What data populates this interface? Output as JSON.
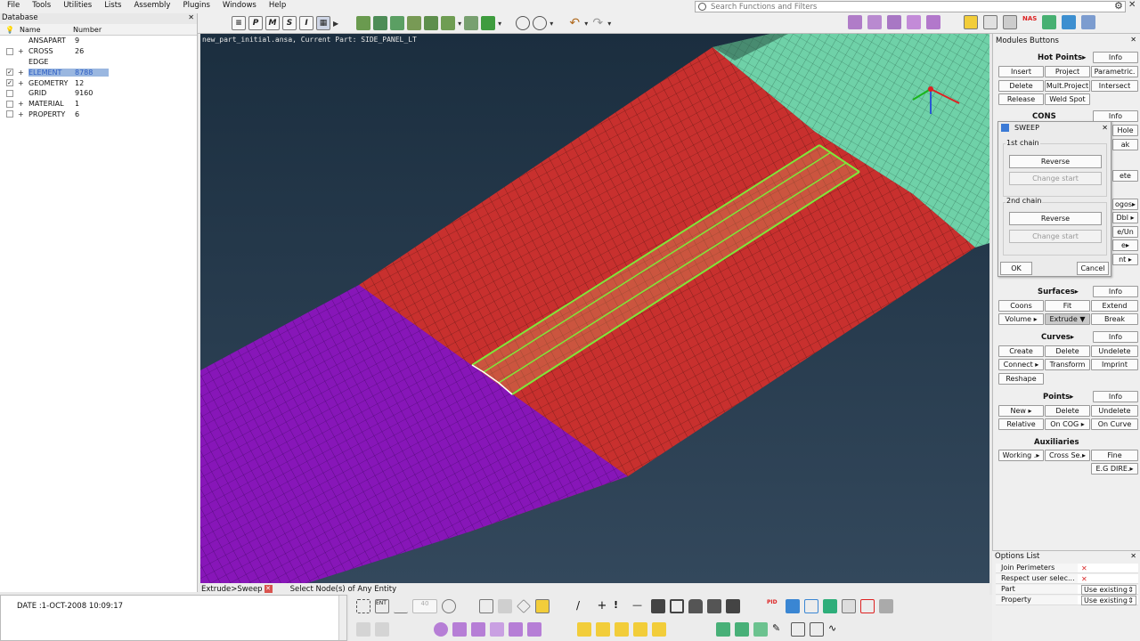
{
  "menu": [
    "File",
    "Tools",
    "Utilities",
    "Lists",
    "Assembly",
    "Plugins",
    "Windows",
    "Help"
  ],
  "search": {
    "placeholder": "Search Functions and Filters"
  },
  "database": {
    "title": "Database",
    "columns": {
      "name": "Name",
      "number": "Number"
    },
    "rows": [
      {
        "name": "ANSAPART",
        "number": "9",
        "checked": false,
        "expandable": false,
        "selected": false
      },
      {
        "name": "CROSS",
        "number": "26",
        "checked": false,
        "expandable": true,
        "selected": false
      },
      {
        "name": "EDGE",
        "number": "",
        "checked": false,
        "expandable": false,
        "selected": false
      },
      {
        "name": "ELEMENT",
        "number": "8788",
        "checked": true,
        "expandable": true,
        "selected": true
      },
      {
        "name": "GEOMETRY",
        "number": "12",
        "checked": true,
        "expandable": true,
        "selected": false
      },
      {
        "name": "GRID",
        "number": "9160",
        "checked": false,
        "expandable": false,
        "selected": false
      },
      {
        "name": "MATERIAL",
        "number": "1",
        "checked": false,
        "expandable": true,
        "selected": false
      },
      {
        "name": "PROPERTY",
        "number": "6",
        "checked": false,
        "expandable": true,
        "selected": false
      }
    ]
  },
  "viewport": {
    "caption": "new_part_initial.ansa,  Current Part: SIDE_PANEL_LT"
  },
  "status": {
    "operation": "Extrude>Sweep",
    "message": "Select Node(s) of Any Entity"
  },
  "log": {
    "text": "DATE :1-OCT-2008  10:09:17"
  },
  "modules": {
    "title": "Modules Buttons",
    "hot_points": {
      "title": "Hot Points▸",
      "info": "Info",
      "buttons": [
        "Insert",
        "Project",
        "Parametric.",
        "Delete",
        "Mult.Project",
        "Intersect",
        "Release",
        "Weld Spot"
      ]
    },
    "cons": {
      "title": "CONS",
      "info": "Info",
      "partial": [
        "Hole",
        "ak",
        "ete",
        "ogos▸",
        "Dbl ▸",
        "e/Un",
        "e▸",
        "nt ▸"
      ]
    },
    "surfaces": {
      "title": "Surfaces▸",
      "info": "Info",
      "buttons": [
        "Coons",
        "Fit",
        "Extend",
        "Volume ▸",
        "Extrude ▼",
        "Break"
      ]
    },
    "curves": {
      "title": "Curves▸",
      "info": "Info",
      "buttons": [
        "Create",
        "Delete",
        "Undelete",
        "Connect ▸",
        "Transform",
        "Imprint",
        "Reshape"
      ]
    },
    "points": {
      "title": "Points▸",
      "info": "Info",
      "buttons": [
        "New ▸",
        "Delete",
        "Undelete",
        "Relative",
        "On COG ▸",
        "On Curve"
      ]
    },
    "auxiliaries": {
      "title": "Auxiliaries",
      "buttons": [
        "Working .▸",
        "Cross Se.▸",
        "Fine",
        "E.G DIRE.▸"
      ]
    }
  },
  "sweep": {
    "title": "SWEEP",
    "chain1": {
      "label": "1st chain",
      "reverse": "Reverse",
      "change_start": "Change start"
    },
    "chain2": {
      "label": "2nd chain",
      "reverse": "Reverse",
      "change_start": "Change start"
    },
    "ok": "OK",
    "cancel": "Cancel"
  },
  "options": {
    "title": "Options List",
    "rows": [
      {
        "name": "Join Perimeters",
        "value": "✕",
        "type": "x"
      },
      {
        "name": "Respect user selec...",
        "value": "✕",
        "type": "x"
      },
      {
        "name": "Part",
        "value": "Use existing",
        "type": "spin"
      },
      {
        "name": "Property",
        "value": "Use existing",
        "type": "spin"
      }
    ]
  },
  "toolbar_letters": [
    "P",
    "M",
    "S",
    "I"
  ],
  "colors": {
    "red_mesh": "#c8302e",
    "purple_mesh": "#8716b8",
    "teal_mesh": "#6fd1a8",
    "green_highlight": "#7fe83a",
    "viewport_bg": "#24384a"
  }
}
